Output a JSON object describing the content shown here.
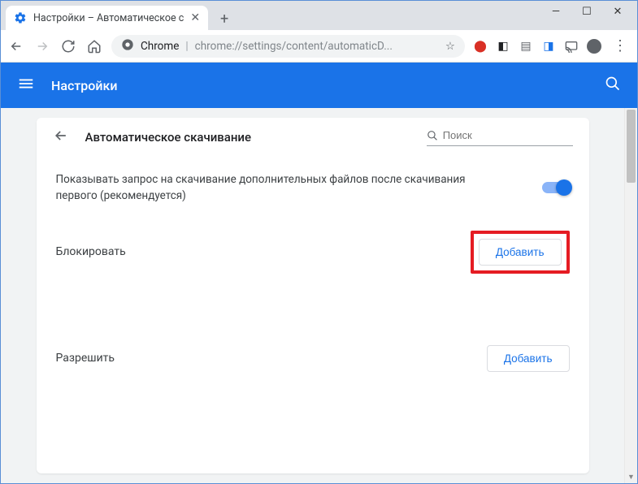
{
  "window": {
    "tab_title": "Настройки – Автоматическое с",
    "omnibox_origin": "Chrome",
    "omnibox_path": "chrome://settings/content/automaticD..."
  },
  "header": {
    "title": "Настройки"
  },
  "page": {
    "title": "Автоматическое скачивание",
    "search_placeholder": "Поиск",
    "toggle_label": "Показывать запрос на скачивание дополнительных файлов после скачивания первого (рекомендуется)",
    "block_section": "Блокировать",
    "allow_section": "Разрешить",
    "add_button": "Добавить"
  }
}
